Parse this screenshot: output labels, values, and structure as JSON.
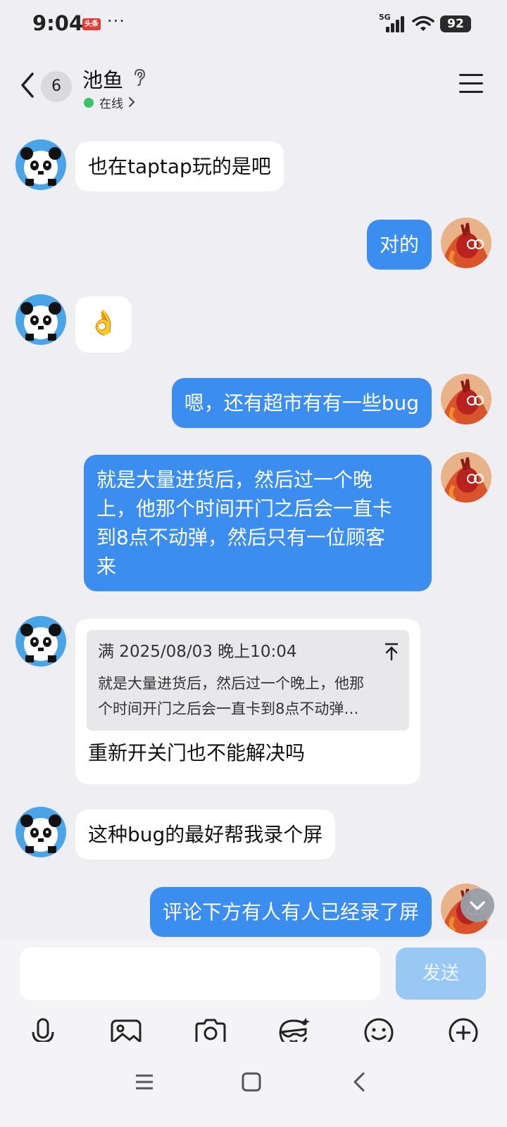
{
  "status_bar": {
    "time": "9:04",
    "news_badge": "头条",
    "more": "···",
    "network": "5G",
    "battery": "92"
  },
  "header": {
    "unread_count": "6",
    "contact_name": "池鱼",
    "status": "在线"
  },
  "messages": [
    {
      "from": "contact",
      "text": "也在taptap玩的是吧"
    },
    {
      "from": "me",
      "text": "对的"
    },
    {
      "from": "contact",
      "emoji": "👌"
    },
    {
      "from": "me",
      "text": "嗯，还有超市有有一些bug"
    },
    {
      "from": "me",
      "lines": [
        "就是大量进货后，然后过一个晚",
        "上，他那个时间开门之后会一直卡",
        "到8点不动弹，然后只有一位顾客",
        "来"
      ]
    },
    {
      "from": "contact",
      "quote": {
        "meta": "满 2025/08/03 晚上10:04",
        "lines": [
          "就是大量进货后，然后过一个晚上，他那",
          "个时间开门之后会一直卡到8点不动弹…"
        ]
      },
      "text": "重新开关门也不能解决吗"
    },
    {
      "from": "contact",
      "text": "这种bug的最好帮我录个屏"
    },
    {
      "from": "me",
      "text": "评论下方有人有人已经录了屏"
    }
  ],
  "composer": {
    "input_value": "",
    "send_label": "发送"
  },
  "toolbar": [
    "mic-icon",
    "image-icon",
    "camera-icon",
    "sticker-icon",
    "emoji-icon",
    "plus-icon"
  ],
  "navigation": [
    "recents-icon",
    "home-icon",
    "back-icon"
  ],
  "colors": {
    "background": "#efeff3",
    "outgoing_bubble": "#3b8ef0",
    "incoming_bubble": "#ffffff",
    "online": "#39c466",
    "send_disabled": "#99c8f5"
  }
}
